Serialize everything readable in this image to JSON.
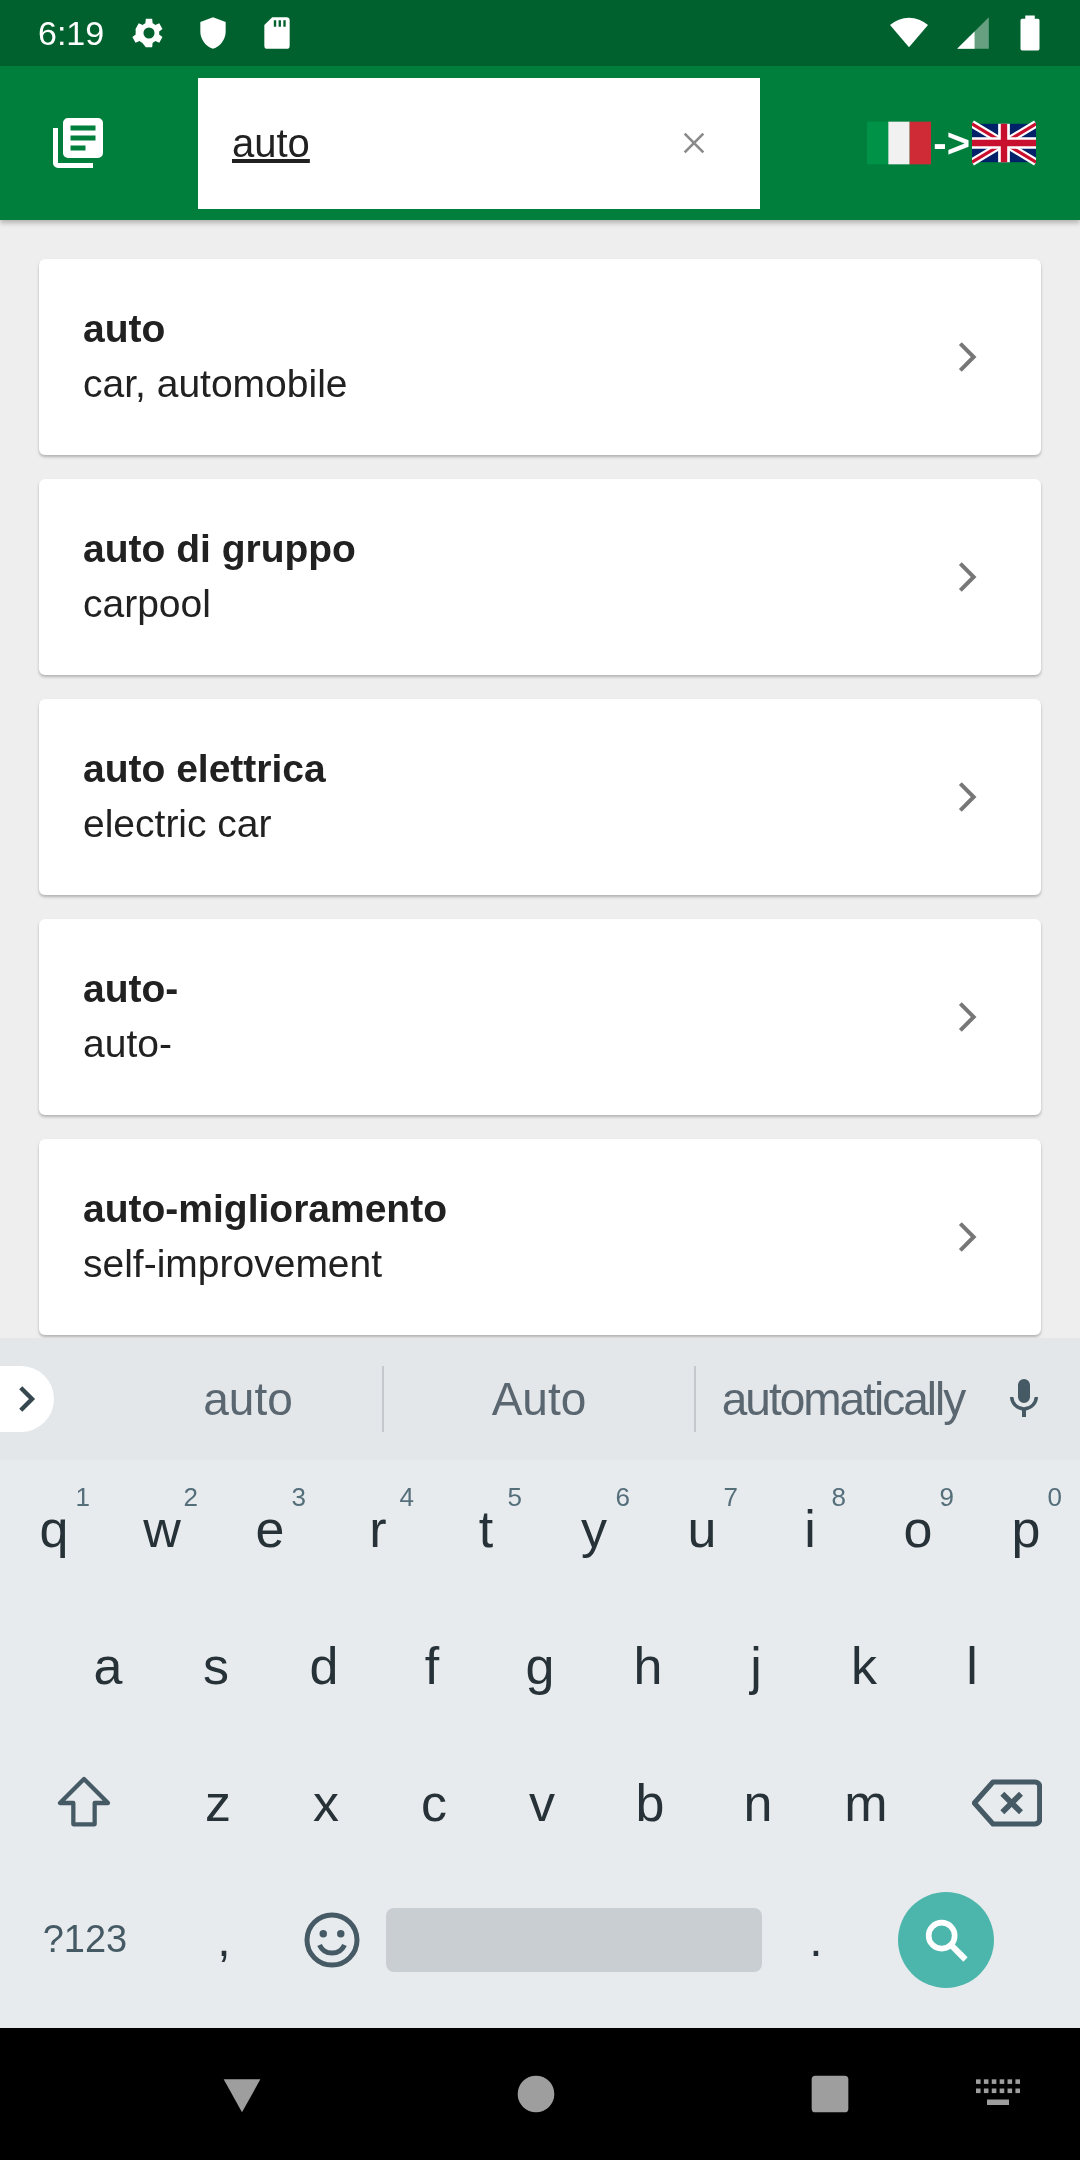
{
  "status_bar": {
    "time": "6:19"
  },
  "search": {
    "value": "auto"
  },
  "language_pair": {
    "arrow": "->"
  },
  "results": [
    {
      "term": "auto",
      "translation": "car, automobile"
    },
    {
      "term": "auto di gruppo",
      "translation": "carpool"
    },
    {
      "term": "auto elettrica",
      "translation": "electric car"
    },
    {
      "term": "auto-",
      "translation": "auto-"
    },
    {
      "term": "auto-miglioramento",
      "translation": "self-improvement"
    }
  ],
  "keyboard": {
    "suggestions": [
      "auto",
      "Auto",
      "automatically"
    ],
    "rows": [
      [
        {
          "key": "q",
          "hint": "1"
        },
        {
          "key": "w",
          "hint": "2"
        },
        {
          "key": "e",
          "hint": "3"
        },
        {
          "key": "r",
          "hint": "4"
        },
        {
          "key": "t",
          "hint": "5"
        },
        {
          "key": "y",
          "hint": "6"
        },
        {
          "key": "u",
          "hint": "7"
        },
        {
          "key": "i",
          "hint": "8"
        },
        {
          "key": "o",
          "hint": "9"
        },
        {
          "key": "p",
          "hint": "0"
        }
      ],
      [
        {
          "key": "a"
        },
        {
          "key": "s"
        },
        {
          "key": "d"
        },
        {
          "key": "f"
        },
        {
          "key": "g"
        },
        {
          "key": "h"
        },
        {
          "key": "j"
        },
        {
          "key": "k"
        },
        {
          "key": "l"
        }
      ],
      [
        {
          "key": "z"
        },
        {
          "key": "x"
        },
        {
          "key": "c"
        },
        {
          "key": "v"
        },
        {
          "key": "b"
        },
        {
          "key": "n"
        },
        {
          "key": "m"
        }
      ]
    ],
    "symbols": "?123",
    "comma": ",",
    "period": "."
  }
}
